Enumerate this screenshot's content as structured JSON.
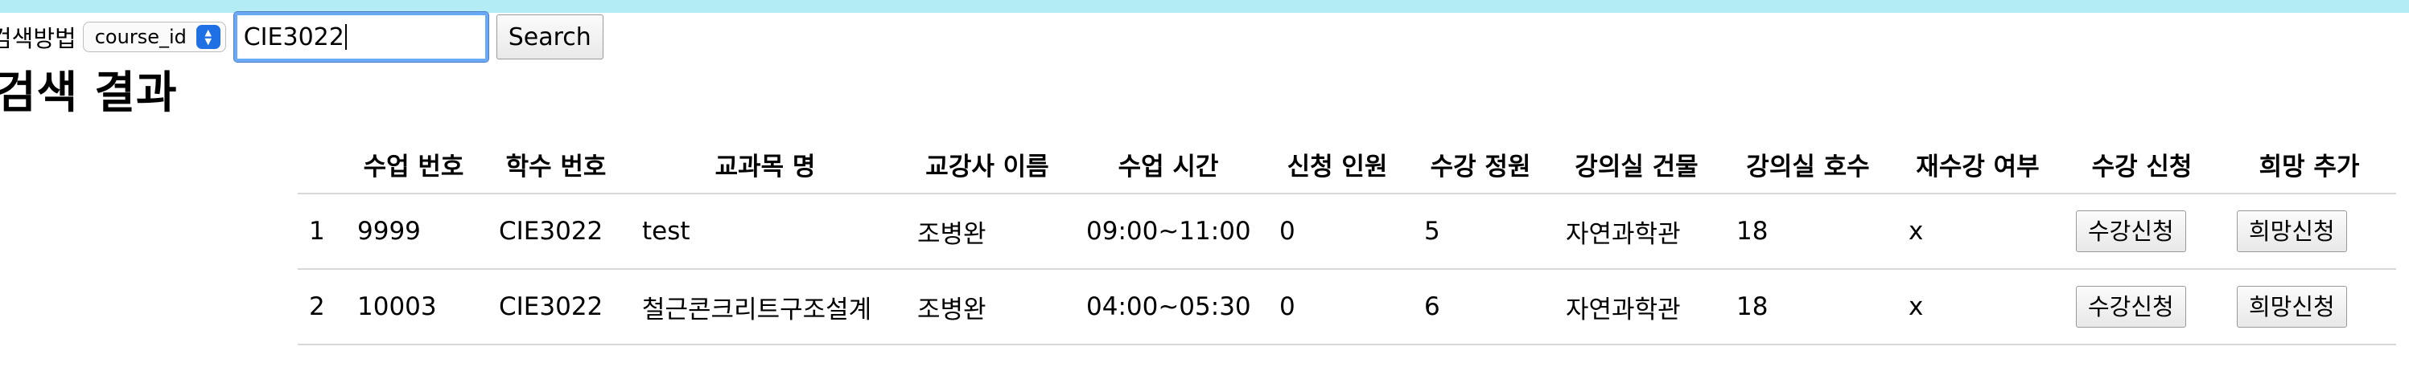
{
  "search": {
    "label": "검색방법",
    "method_selected": "course_id",
    "query_value": "CIE3022",
    "button_label": "Search"
  },
  "results": {
    "title": "검색 결과",
    "columns": [
      "",
      "수업 번호",
      "학수 번호",
      "교과목 명",
      "교강사 이름",
      "수업 시간",
      "신청 인원",
      "수강 정원",
      "강의실 건물",
      "강의실 호수",
      "재수강 여부",
      "수강 신청",
      "희망 추가"
    ],
    "rows": [
      {
        "index": "1",
        "class_no": "9999",
        "course_id": "CIE3022",
        "course_name": "test",
        "instructor": "조병완",
        "time": "09:00~11:00",
        "applicants": "0",
        "capacity": "5",
        "building": "자연과학관",
        "room": "18",
        "retake": "x",
        "enroll_label": "수강신청",
        "wish_label": "희망신청"
      },
      {
        "index": "2",
        "class_no": "10003",
        "course_id": "CIE3022",
        "course_name": "철근콘크리트구조설계",
        "instructor": "조병완",
        "time": "04:00~05:30",
        "applicants": "0",
        "capacity": "6",
        "building": "자연과학관",
        "room": "18",
        "retake": "x",
        "enroll_label": "수강신청",
        "wish_label": "희망신청"
      }
    ]
  },
  "icons": {
    "select_stepper": "chevron-up-down-icon"
  },
  "colors": {
    "top_strip": "#b3ecf5",
    "input_focus_ring": "#6aa9f3",
    "select_stepper": "#1f6fe5"
  }
}
